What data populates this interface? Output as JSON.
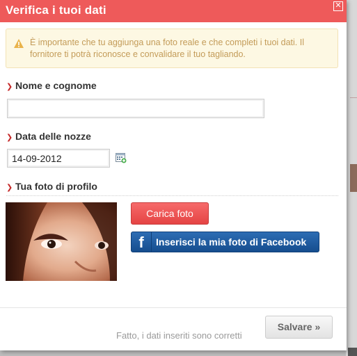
{
  "modal": {
    "title": "Verifica i tuoi dati",
    "close_icon": "close-icon",
    "alert": {
      "icon": "warning-icon",
      "text": "È importante che tu aggiunga una foto reale e che completi i tuoi dati. Il fornitore ti potrà riconosce e convalidare il tuo tagliando."
    },
    "fields": {
      "name_label": "Nome e cognome",
      "name_value": "",
      "date_label": "Data delle nozze",
      "date_value": "14-09-2012",
      "photo_label": "Tua foto di profilo"
    },
    "buttons": {
      "upload_label": "Carica foto",
      "facebook_logo": "f",
      "facebook_label": "Inserisci la mia foto di Facebook",
      "save_label": "Salvare »"
    },
    "footer_note": "Fatto, i dati inseriti sono corretti"
  },
  "colors": {
    "header": "#ee5a5a",
    "alert_bg": "#fdf8e3",
    "alert_text": "#c39b58",
    "bullet": "#c52828",
    "upload_button": "#e54444",
    "facebook_button": "#1f5ea3"
  }
}
